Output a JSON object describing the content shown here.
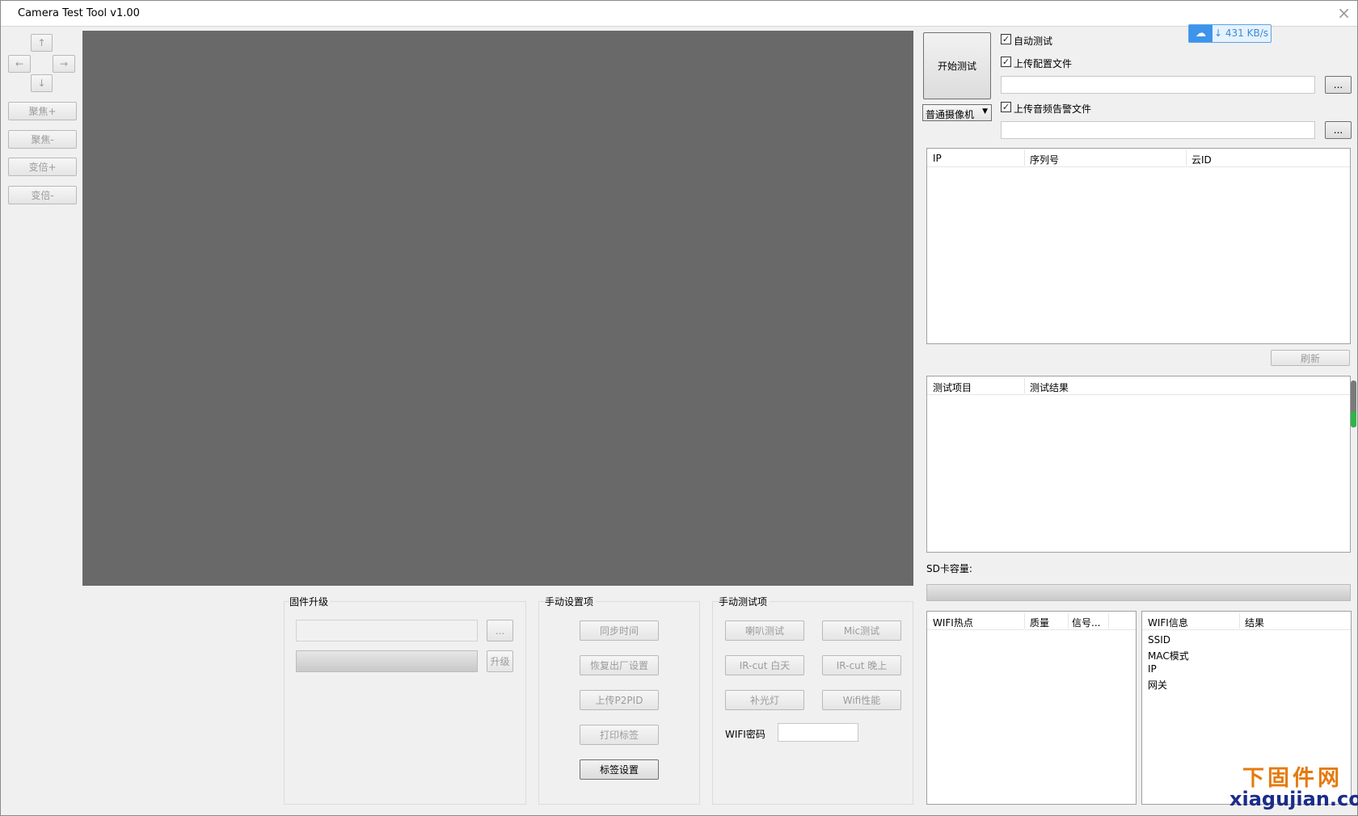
{
  "window": {
    "title": "Camera Test Tool v1.00",
    "close_glyph": "×"
  },
  "ptz": {
    "up": "↑",
    "left": "←",
    "right": "→",
    "down": "↓",
    "focus_plus": "聚焦+",
    "focus_minus": "聚焦-",
    "zoom_plus": "变倍+",
    "zoom_minus": "变倍-"
  },
  "speed_widget": {
    "icon": "cloud-icon",
    "text": "↓ 431 KB/s"
  },
  "test_panel": {
    "start_button": "开始测试",
    "camera_type": "普通摄像机",
    "auto_test": "自动测试",
    "upload_config": "上传配置文件",
    "upload_audio_alarm": "上传音频告警文件",
    "browse": "..."
  },
  "device_table": {
    "columns": [
      "IP",
      "序列号",
      "云ID"
    ],
    "refresh": "刷新"
  },
  "result_table": {
    "columns": [
      "测试项目",
      "测试结果"
    ]
  },
  "sd_card": {
    "label": "SD卡容量:"
  },
  "firmware": {
    "group": "固件升级",
    "browse": "...",
    "upgrade": "升级"
  },
  "manual_settings": {
    "group": "手动设置项",
    "buttons": [
      "同步时间",
      "恢复出厂设置",
      "上传P2PID",
      "打印标签",
      "标签设置"
    ]
  },
  "manual_tests": {
    "group": "手动测试项",
    "speaker": "喇叭测试",
    "mic": "Mic测试",
    "ircut_day": "IR-cut 白天",
    "ircut_night": "IR-cut 晚上",
    "fill_light": "补光灯",
    "wifi_perf": "Wifi性能",
    "wifi_password_label": "WIFI密码"
  },
  "wifi_hotspot": {
    "columns": [
      "WIFI热点",
      "质量",
      "信号..."
    ]
  },
  "wifi_info": {
    "columns": [
      "WIFI信息",
      "结果"
    ],
    "rows": [
      "SSID",
      "MAC模式",
      "IP",
      "网关"
    ]
  },
  "watermark": {
    "line1": "下固件网",
    "line2": "xiagujian.com"
  }
}
